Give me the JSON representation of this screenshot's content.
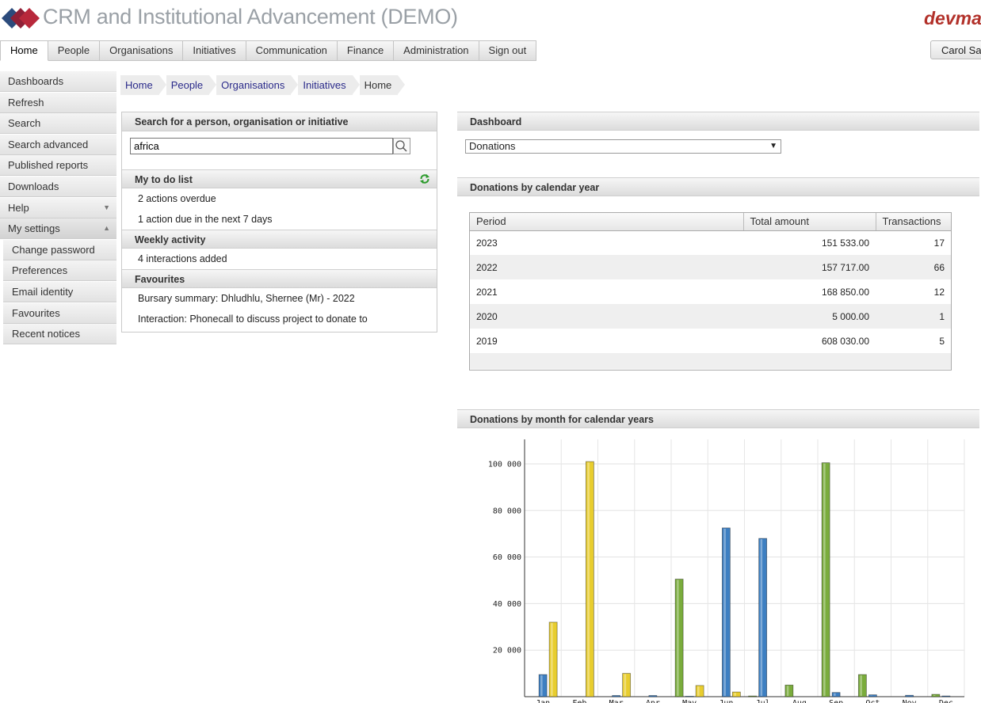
{
  "app": {
    "title": "CRM and Institutional Advancement (DEMO)",
    "brand": "devma",
    "user": "Carol Sa"
  },
  "nav": {
    "tabs": [
      "Home",
      "People",
      "Organisations",
      "Initiatives",
      "Communication",
      "Finance",
      "Administration",
      "Sign out"
    ],
    "active": "Home"
  },
  "sidebar": {
    "items": [
      "Dashboards",
      "Refresh",
      "Search",
      "Search advanced",
      "Published reports",
      "Downloads",
      "Help",
      "My settings"
    ],
    "sub_items": [
      "Change password",
      "Preferences",
      "Email identity",
      "Favourites",
      "Recent notices"
    ]
  },
  "breadcrumbs": [
    "Home",
    "People",
    "Organisations",
    "Initiatives",
    "Home"
  ],
  "search": {
    "heading": "Search for a person, organisation or initiative",
    "value": "africa"
  },
  "todo": {
    "heading": "My to do list",
    "items": [
      "2 actions overdue",
      "1 action due in the next 7 days"
    ]
  },
  "weekly": {
    "heading": "Weekly activity",
    "items": [
      "4 interactions added"
    ]
  },
  "favourites": {
    "heading": "Favourites",
    "items": [
      "Bursary summary: Dhludhlu, Shernee (Mr) - 2022",
      "Interaction: Phonecall to discuss project to donate to"
    ]
  },
  "dashboard": {
    "heading": "Dashboard",
    "selected": "Donations"
  },
  "year_table": {
    "heading": "Donations by calendar year",
    "columns": [
      "Period",
      "Total amount",
      "Transactions"
    ],
    "rows": [
      [
        "2023",
        "151 533.00",
        "17"
      ],
      [
        "2022",
        "157 717.00",
        "66"
      ],
      [
        "2021",
        "168 850.00",
        "12"
      ],
      [
        "2020",
        "5 000.00",
        "1"
      ],
      [
        "2019",
        "608 030.00",
        "5"
      ]
    ]
  },
  "chart_heading": "Donations by month for calendar years",
  "colors": {
    "blue": "#3d7fc2",
    "green": "#7aac3c",
    "yellow": "#e8cd2e"
  },
  "chart_data": {
    "type": "bar",
    "categories": [
      "Jan",
      "Feb",
      "Mar",
      "Apr",
      "May",
      "Jun",
      "Jul",
      "Aug",
      "Sep",
      "Oct",
      "Nov",
      "Dec"
    ],
    "series": [
      {
        "color": "#7aac3c",
        "values": [
          0,
          0,
          0,
          0,
          50500,
          0,
          300,
          5000,
          100500,
          9500,
          0,
          1000
        ]
      },
      {
        "color": "#3d7fc2",
        "values": [
          9500,
          0,
          500,
          500,
          200,
          72500,
          68000,
          0,
          1800,
          800,
          600,
          300
        ]
      },
      {
        "color": "#e8cd2e",
        "values": [
          32000,
          101000,
          10000,
          0,
          4800,
          2000,
          0,
          0,
          0,
          0,
          0,
          0
        ]
      }
    ],
    "yticks": [
      "20 000",
      "40 000",
      "60 000",
      "80 000",
      "100 000"
    ],
    "ytick_values": [
      20000,
      40000,
      60000,
      80000,
      100000
    ],
    "ylim": [
      0,
      110000
    ],
    "grid": true
  }
}
